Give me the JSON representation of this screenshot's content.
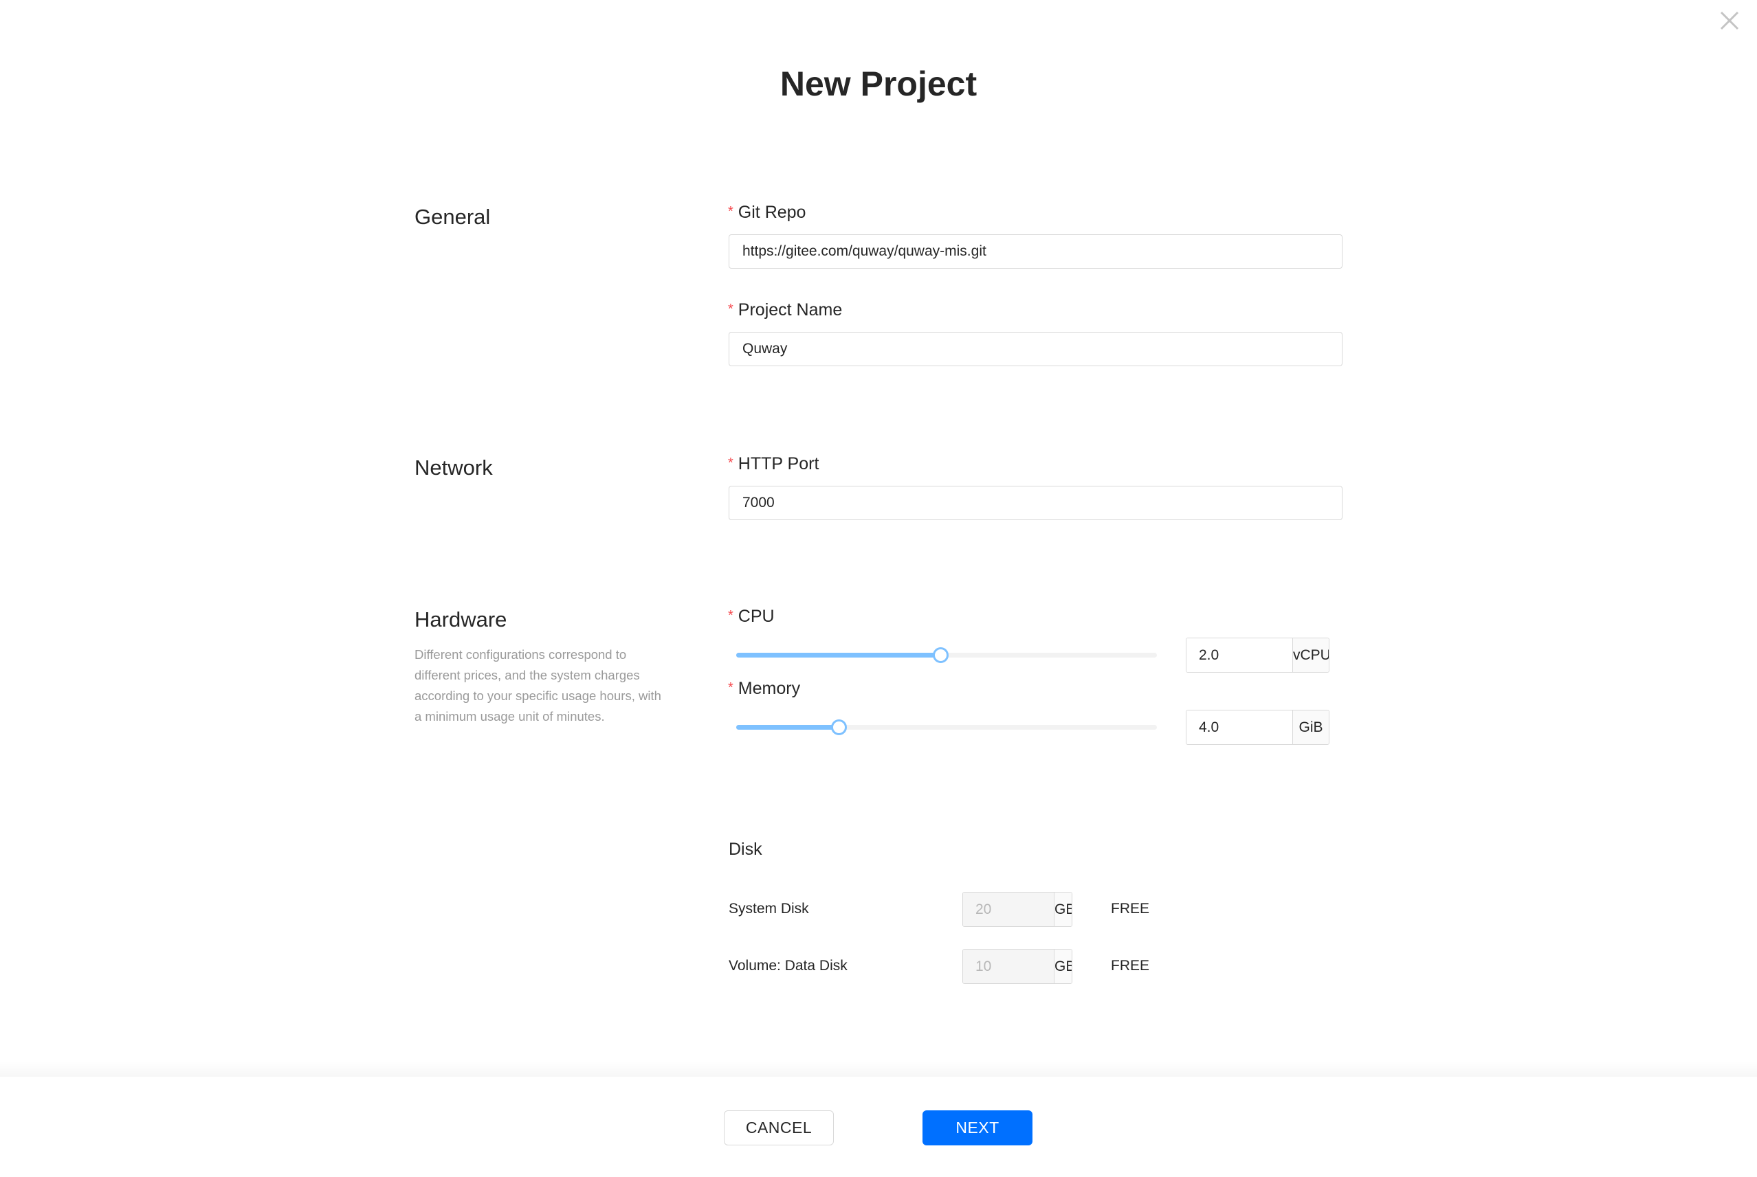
{
  "dialog": {
    "title": "New Project",
    "close_icon": "close-x-icon"
  },
  "sections": {
    "general": {
      "title": "General"
    },
    "network": {
      "title": "Network"
    },
    "hardware": {
      "title": "Hardware",
      "description": "Different configurations correspond to different prices, and the system charges according to your specific usage hours, with a minimum usage unit of minutes."
    }
  },
  "fields": {
    "required_marker": "*",
    "git_repo": {
      "label": "Git Repo",
      "value": "https://gitee.com/quway/quway-mis.git"
    },
    "project_name": {
      "label": "Project Name",
      "value": "Quway"
    },
    "http_port": {
      "label": "HTTP Port",
      "value": "7000"
    },
    "cpu": {
      "label": "CPU",
      "value": "2.0",
      "unit": "vCPU",
      "slider_fraction": 0.485
    },
    "memory": {
      "label": "Memory",
      "value": "4.0",
      "unit": "GiB",
      "slider_fraction": 0.243
    }
  },
  "disk": {
    "label": "Disk",
    "rows": [
      {
        "label": "System Disk",
        "value": "20",
        "unit": "GB",
        "price": "FREE"
      },
      {
        "label": "Volume: Data Disk",
        "value": "10",
        "unit": "GB",
        "price": "FREE"
      }
    ]
  },
  "footer": {
    "cancel_label": "CANCEL",
    "next_label": "NEXT"
  },
  "colors": {
    "primary": "#0070ff",
    "slider": "#7ec1ff",
    "required": "#f5484d"
  }
}
